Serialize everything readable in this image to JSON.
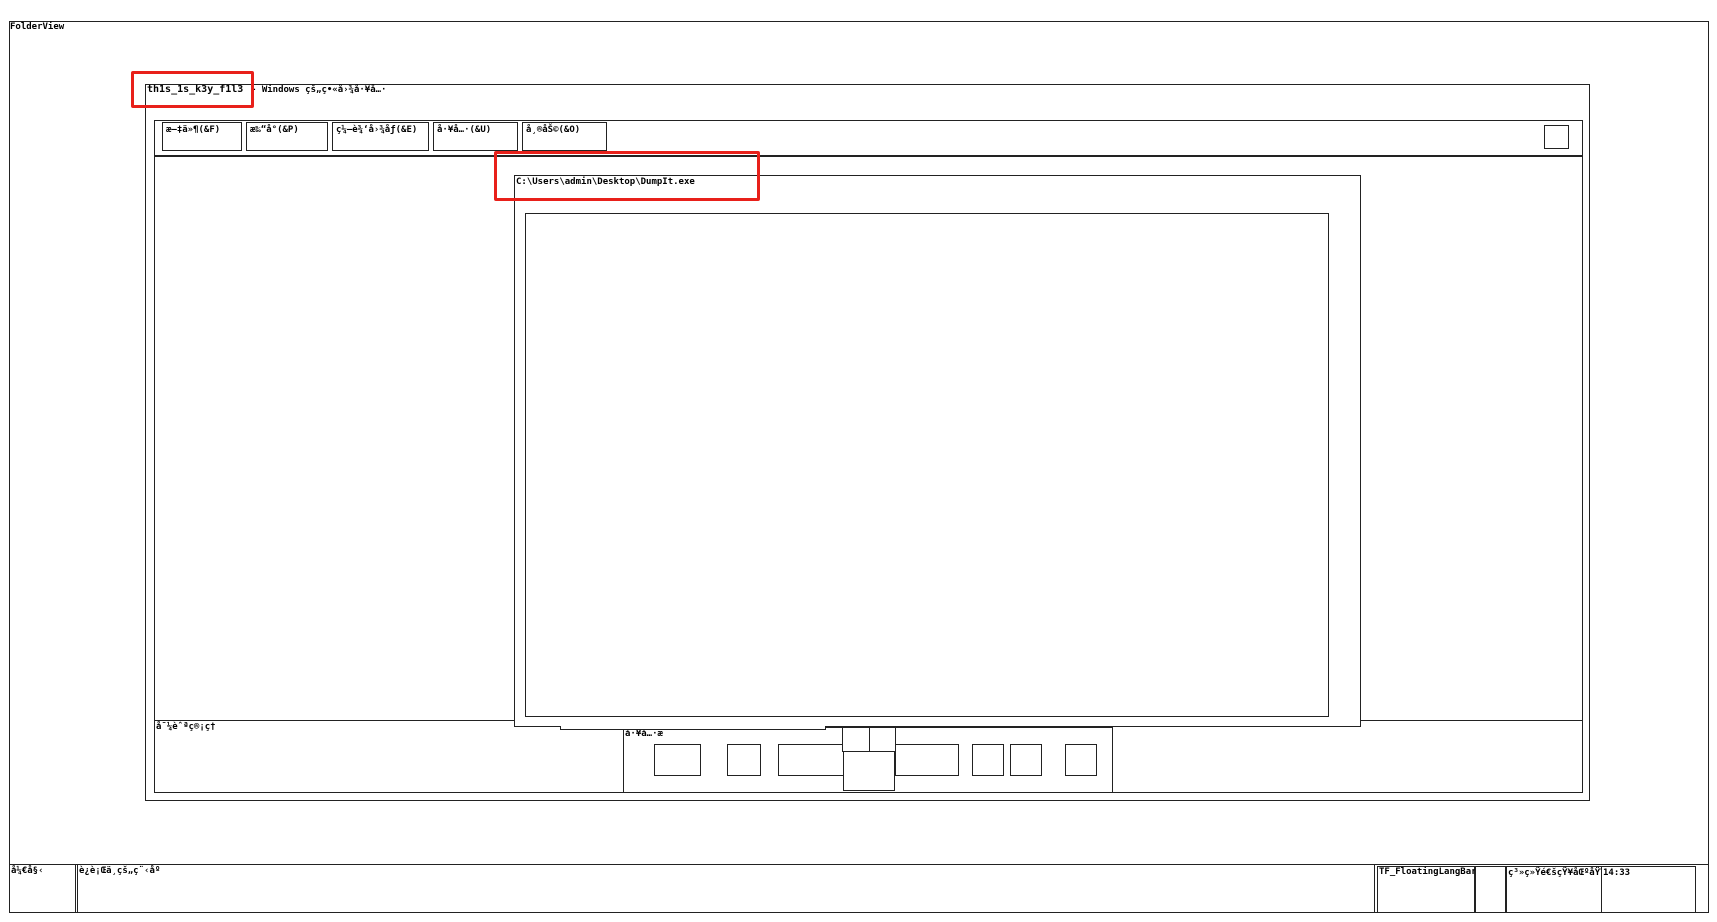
{
  "desktop": {
    "title": "FolderView"
  },
  "main_window": {
    "title_key": "th1s_1s_k3y_f1l3",
    "title_suffix": "- Windows çš„ç•«å›¾å·¥å…·",
    "menu": [
      "æ–‡ä»¶(&F)",
      "æ‰“å°(&P)",
      "ç¼–è¾‘å›¾åƒ(&E)",
      "å·¥å…·(&U)",
      "å¸®åŠ©(&O)"
    ],
    "status_label": "å¯¼èˆªç®¡ç†"
  },
  "dialog": {
    "title": "C:\\Users\\admin\\Desktop\\DumpIt.exe"
  },
  "toolbar_panel": {
    "label": "å·¥å…·æ "
  },
  "taskbar": {
    "start_label": "å¼€å§‹",
    "task_label": "è¿è¡Œä¸­çš„ç¨‹åº",
    "lang_bar": "TF_FloatingLangBar",
    "tray_label": "ç³»ç»Ÿé€šçŸ¥åŒºåŸŸ",
    "clock": "14:33"
  }
}
